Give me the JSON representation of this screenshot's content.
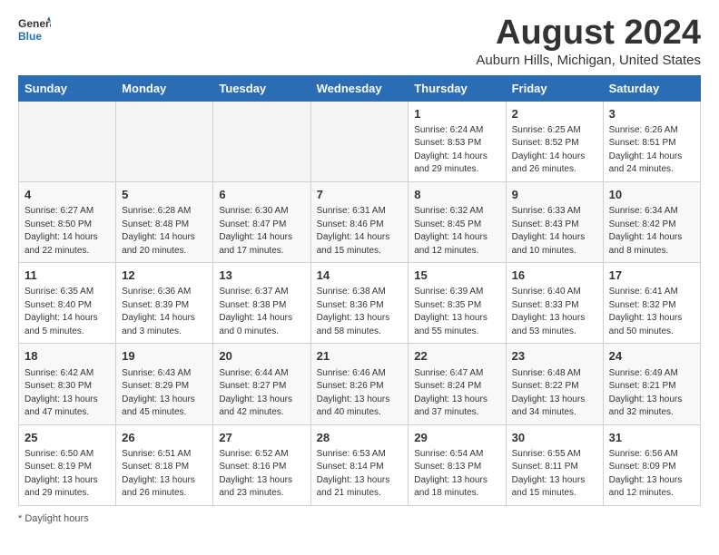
{
  "header": {
    "logo_general": "General",
    "logo_blue": "Blue",
    "month_title": "August 2024",
    "location": "Auburn Hills, Michigan, United States"
  },
  "footer": {
    "note": "Daylight hours"
  },
  "weekdays": [
    "Sunday",
    "Monday",
    "Tuesday",
    "Wednesday",
    "Thursday",
    "Friday",
    "Saturday"
  ],
  "weeks": [
    [
      {
        "day": "",
        "info": ""
      },
      {
        "day": "",
        "info": ""
      },
      {
        "day": "",
        "info": ""
      },
      {
        "day": "",
        "info": ""
      },
      {
        "day": "1",
        "info": "Sunrise: 6:24 AM\nSunset: 8:53 PM\nDaylight: 14 hours and 29 minutes."
      },
      {
        "day": "2",
        "info": "Sunrise: 6:25 AM\nSunset: 8:52 PM\nDaylight: 14 hours and 26 minutes."
      },
      {
        "day": "3",
        "info": "Sunrise: 6:26 AM\nSunset: 8:51 PM\nDaylight: 14 hours and 24 minutes."
      }
    ],
    [
      {
        "day": "4",
        "info": "Sunrise: 6:27 AM\nSunset: 8:50 PM\nDaylight: 14 hours and 22 minutes."
      },
      {
        "day": "5",
        "info": "Sunrise: 6:28 AM\nSunset: 8:48 PM\nDaylight: 14 hours and 20 minutes."
      },
      {
        "day": "6",
        "info": "Sunrise: 6:30 AM\nSunset: 8:47 PM\nDaylight: 14 hours and 17 minutes."
      },
      {
        "day": "7",
        "info": "Sunrise: 6:31 AM\nSunset: 8:46 PM\nDaylight: 14 hours and 15 minutes."
      },
      {
        "day": "8",
        "info": "Sunrise: 6:32 AM\nSunset: 8:45 PM\nDaylight: 14 hours and 12 minutes."
      },
      {
        "day": "9",
        "info": "Sunrise: 6:33 AM\nSunset: 8:43 PM\nDaylight: 14 hours and 10 minutes."
      },
      {
        "day": "10",
        "info": "Sunrise: 6:34 AM\nSunset: 8:42 PM\nDaylight: 14 hours and 8 minutes."
      }
    ],
    [
      {
        "day": "11",
        "info": "Sunrise: 6:35 AM\nSunset: 8:40 PM\nDaylight: 14 hours and 5 minutes."
      },
      {
        "day": "12",
        "info": "Sunrise: 6:36 AM\nSunset: 8:39 PM\nDaylight: 14 hours and 3 minutes."
      },
      {
        "day": "13",
        "info": "Sunrise: 6:37 AM\nSunset: 8:38 PM\nDaylight: 14 hours and 0 minutes."
      },
      {
        "day": "14",
        "info": "Sunrise: 6:38 AM\nSunset: 8:36 PM\nDaylight: 13 hours and 58 minutes."
      },
      {
        "day": "15",
        "info": "Sunrise: 6:39 AM\nSunset: 8:35 PM\nDaylight: 13 hours and 55 minutes."
      },
      {
        "day": "16",
        "info": "Sunrise: 6:40 AM\nSunset: 8:33 PM\nDaylight: 13 hours and 53 minutes."
      },
      {
        "day": "17",
        "info": "Sunrise: 6:41 AM\nSunset: 8:32 PM\nDaylight: 13 hours and 50 minutes."
      }
    ],
    [
      {
        "day": "18",
        "info": "Sunrise: 6:42 AM\nSunset: 8:30 PM\nDaylight: 13 hours and 47 minutes."
      },
      {
        "day": "19",
        "info": "Sunrise: 6:43 AM\nSunset: 8:29 PM\nDaylight: 13 hours and 45 minutes."
      },
      {
        "day": "20",
        "info": "Sunrise: 6:44 AM\nSunset: 8:27 PM\nDaylight: 13 hours and 42 minutes."
      },
      {
        "day": "21",
        "info": "Sunrise: 6:46 AM\nSunset: 8:26 PM\nDaylight: 13 hours and 40 minutes."
      },
      {
        "day": "22",
        "info": "Sunrise: 6:47 AM\nSunset: 8:24 PM\nDaylight: 13 hours and 37 minutes."
      },
      {
        "day": "23",
        "info": "Sunrise: 6:48 AM\nSunset: 8:22 PM\nDaylight: 13 hours and 34 minutes."
      },
      {
        "day": "24",
        "info": "Sunrise: 6:49 AM\nSunset: 8:21 PM\nDaylight: 13 hours and 32 minutes."
      }
    ],
    [
      {
        "day": "25",
        "info": "Sunrise: 6:50 AM\nSunset: 8:19 PM\nDaylight: 13 hours and 29 minutes."
      },
      {
        "day": "26",
        "info": "Sunrise: 6:51 AM\nSunset: 8:18 PM\nDaylight: 13 hours and 26 minutes."
      },
      {
        "day": "27",
        "info": "Sunrise: 6:52 AM\nSunset: 8:16 PM\nDaylight: 13 hours and 23 minutes."
      },
      {
        "day": "28",
        "info": "Sunrise: 6:53 AM\nSunset: 8:14 PM\nDaylight: 13 hours and 21 minutes."
      },
      {
        "day": "29",
        "info": "Sunrise: 6:54 AM\nSunset: 8:13 PM\nDaylight: 13 hours and 18 minutes."
      },
      {
        "day": "30",
        "info": "Sunrise: 6:55 AM\nSunset: 8:11 PM\nDaylight: 13 hours and 15 minutes."
      },
      {
        "day": "31",
        "info": "Sunrise: 6:56 AM\nSunset: 8:09 PM\nDaylight: 13 hours and 12 minutes."
      }
    ]
  ]
}
